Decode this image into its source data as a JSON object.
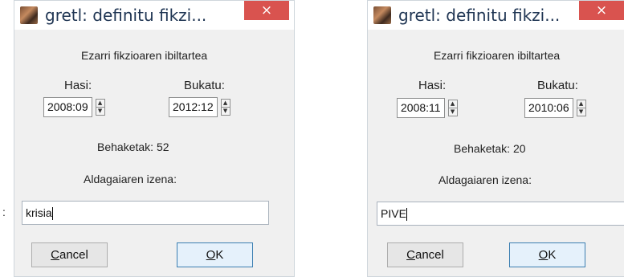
{
  "left_dialog": {
    "title": "gretl: definitu fikzi...",
    "close_glyph": "×",
    "heading": "Ezarri fikzioaren ibiltartea",
    "start_label": "Hasi:",
    "end_label": "Bukatu:",
    "start_value": "2008:09",
    "end_value": "2012:12",
    "observations": "Behaketak: 52",
    "varname_label": "Aldagaiaren izena:",
    "varname_value": "krisia",
    "cancel_accel": "C",
    "cancel_rest": "ancel",
    "ok_accel": "O",
    "ok_rest": "K"
  },
  "right_dialog": {
    "title": "gretl: definitu fikzi...",
    "close_glyph": "×",
    "heading": "Ezarri fikzioaren ibiltartea",
    "start_label": "Hasi:",
    "end_label": "Bukatu:",
    "start_value": "2008:11",
    "end_value": "2010:06",
    "observations": "Behaketak: 20",
    "varname_label": "Aldagaiaren izena:",
    "varname_value": "PIVE",
    "cancel_accel": "C",
    "cancel_rest": "ancel",
    "ok_accel": "O",
    "ok_rest": "K"
  },
  "spin_arrows": {
    "up": "▲",
    "down": "▼"
  },
  "stray_mark": ":"
}
